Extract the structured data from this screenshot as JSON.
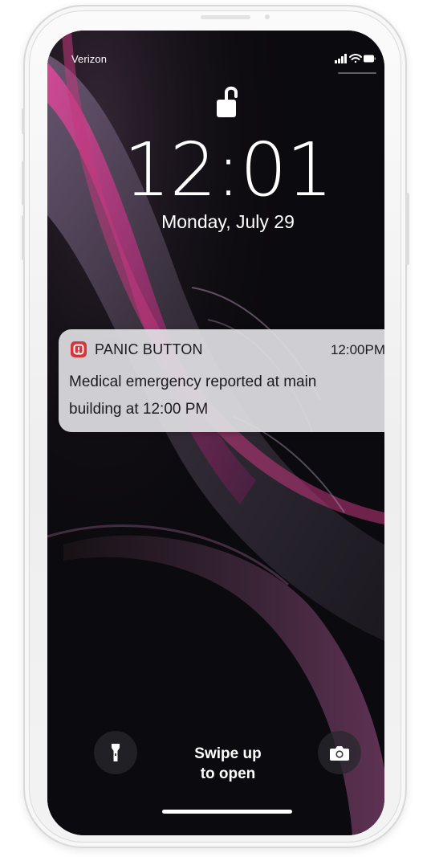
{
  "status_bar": {
    "carrier": "Verizon",
    "icons": [
      "signal-icon",
      "wifi-icon",
      "battery-icon"
    ]
  },
  "lock_screen": {
    "lock_icon": "unlocked-padlock-icon",
    "time": "12:01",
    "date": "Monday, July 29"
  },
  "notification": {
    "app_icon": "panic-button-app-icon",
    "app_name": "PANIC BUTTON",
    "time": "12:00PM",
    "body_line1": "Medical emergency reported at main",
    "body_line2": "building at 12:00 PM"
  },
  "bottom_controls": {
    "flashlight_icon": "flashlight-icon",
    "camera_icon": "camera-icon",
    "swipe_line1": "Swipe up",
    "swipe_line2": "to open"
  },
  "colors": {
    "notification_icon": "#d8343b",
    "wallpaper_accent": "#c2387e",
    "wallpaper_base": "#0b0a0e"
  }
}
